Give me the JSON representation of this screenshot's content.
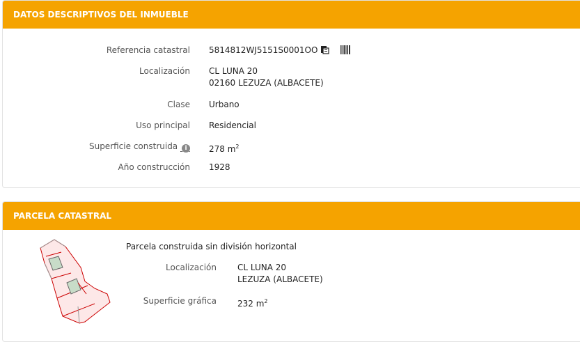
{
  "section1": {
    "header": "DATOS DESCRIPTIVOS DEL INMUEBLE",
    "fields": [
      {
        "label": "Referencia catastral",
        "value": "5814812WJ5151S0001OO"
      },
      {
        "label": "Localización",
        "value_line1": "CL LUNA 20",
        "value_line2": "02160 LEZUZA (ALBACETE)"
      },
      {
        "label": "Clase",
        "value": "Urbano"
      },
      {
        "label": "Uso principal",
        "value": "Residencial"
      },
      {
        "label": "Superficie construida",
        "value": "278 m",
        "unit_sup": "2",
        "info_icon": "i"
      },
      {
        "label": "Año construcción",
        "value": "1928"
      }
    ],
    "icons": [
      "copy-icon",
      "barcode-icon",
      "info-icon"
    ]
  },
  "section2": {
    "header": "PARCELA CATASTRAL",
    "subtitle": "Parcela construida sin división horizontal",
    "fields": [
      {
        "label": "Localización",
        "value_line1": "CL LUNA 20",
        "value_line2": "LEZUZA (ALBACETE)"
      },
      {
        "label": "Superficie gráfica",
        "value": "232 m",
        "unit_sup": "2"
      }
    ]
  },
  "colors": {
    "header_bg": "#f5a300",
    "parcel_fill": "#fde8e8",
    "parcel_stroke": "#cc0000",
    "building_fill": "#c8dcc8"
  }
}
